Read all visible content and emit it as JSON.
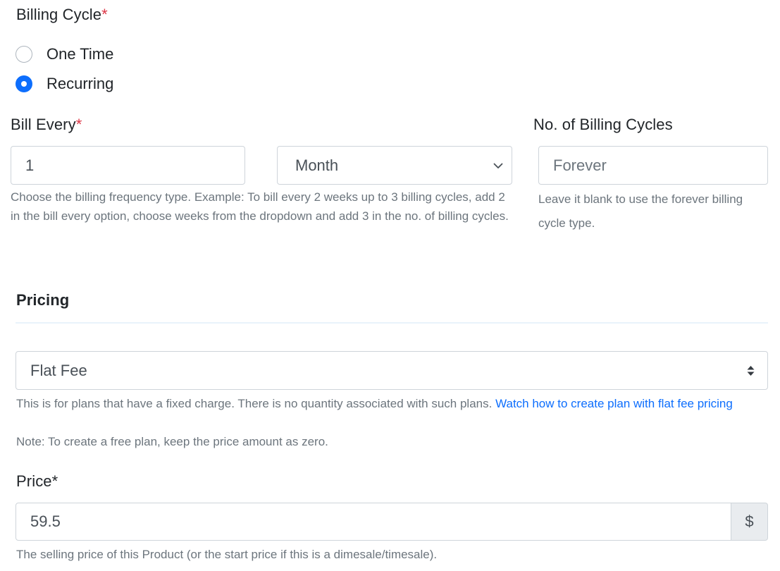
{
  "billing_cycle": {
    "label": "Billing Cycle",
    "required_mark": "*",
    "options": [
      {
        "label": "One Time",
        "checked": false
      },
      {
        "label": "Recurring",
        "checked": true
      }
    ]
  },
  "bill_every": {
    "label": "Bill Every",
    "required_mark": "*",
    "value": "1",
    "unit_selected": "Month",
    "help": "Choose the billing frequency type. Example: To bill every 2 weeks up to 3 billing cycles, add 2 in the bill every option, choose weeks from the dropdown and add 3 in the no. of billing cycles."
  },
  "billing_cycles_count": {
    "label": "No. of Billing Cycles",
    "placeholder": "Forever",
    "help": "Leave it blank to use the forever billing cycle type."
  },
  "pricing": {
    "title": "Pricing",
    "model_selected": "Flat Fee",
    "help_text": "This is for plans that have a fixed charge. There is no quantity associated with such plans.",
    "help_link": "Watch how to create plan with flat fee pricing",
    "note": "Note: To create a free plan, keep the price amount as zero."
  },
  "price": {
    "label": "Price*",
    "value": "59.5",
    "currency_symbol": "$",
    "help": "The selling price of this Product (or the start price if this is a dimesale/timesale)."
  },
  "colors": {
    "primary": "#0d6efd",
    "required": "#dc3545",
    "muted": "#6c757d",
    "border": "#ced4da"
  }
}
